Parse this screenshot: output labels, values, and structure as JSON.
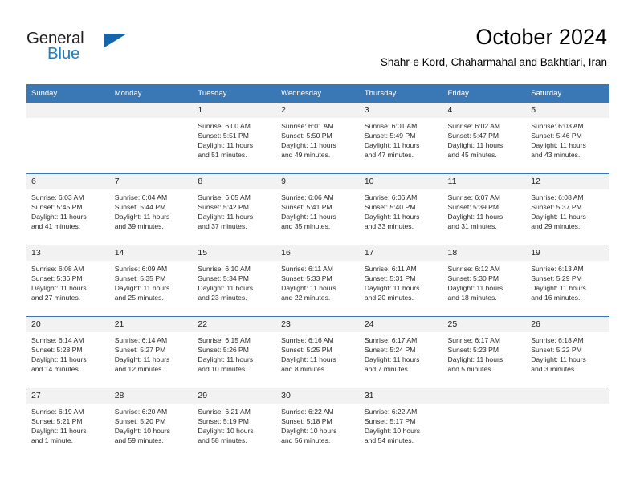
{
  "brand": {
    "name_part1": "General",
    "name_part2": "Blue",
    "logo_icon": "triangle-logo-icon",
    "accent_color": "#1f7fc4",
    "header_color": "#3a78b5"
  },
  "header": {
    "title": "October 2024",
    "subtitle": "Shahr-e Kord, Chaharmahal and Bakhtiari, Iran"
  },
  "weekday_headers": [
    "Sunday",
    "Monday",
    "Tuesday",
    "Wednesday",
    "Thursday",
    "Friday",
    "Saturday"
  ],
  "weeks": [
    [
      {
        "day": "",
        "empty": true,
        "sunrise": "",
        "sunset": "",
        "daylight1": "",
        "daylight2": ""
      },
      {
        "day": "",
        "empty": true,
        "sunrise": "",
        "sunset": "",
        "daylight1": "",
        "daylight2": ""
      },
      {
        "day": "1",
        "sunrise": "Sunrise: 6:00 AM",
        "sunset": "Sunset: 5:51 PM",
        "daylight1": "Daylight: 11 hours",
        "daylight2": "and 51 minutes."
      },
      {
        "day": "2",
        "sunrise": "Sunrise: 6:01 AM",
        "sunset": "Sunset: 5:50 PM",
        "daylight1": "Daylight: 11 hours",
        "daylight2": "and 49 minutes."
      },
      {
        "day": "3",
        "sunrise": "Sunrise: 6:01 AM",
        "sunset": "Sunset: 5:49 PM",
        "daylight1": "Daylight: 11 hours",
        "daylight2": "and 47 minutes."
      },
      {
        "day": "4",
        "sunrise": "Sunrise: 6:02 AM",
        "sunset": "Sunset: 5:47 PM",
        "daylight1": "Daylight: 11 hours",
        "daylight2": "and 45 minutes."
      },
      {
        "day": "5",
        "sunrise": "Sunrise: 6:03 AM",
        "sunset": "Sunset: 5:46 PM",
        "daylight1": "Daylight: 11 hours",
        "daylight2": "and 43 minutes."
      }
    ],
    [
      {
        "day": "6",
        "sunrise": "Sunrise: 6:03 AM",
        "sunset": "Sunset: 5:45 PM",
        "daylight1": "Daylight: 11 hours",
        "daylight2": "and 41 minutes."
      },
      {
        "day": "7",
        "sunrise": "Sunrise: 6:04 AM",
        "sunset": "Sunset: 5:44 PM",
        "daylight1": "Daylight: 11 hours",
        "daylight2": "and 39 minutes."
      },
      {
        "day": "8",
        "sunrise": "Sunrise: 6:05 AM",
        "sunset": "Sunset: 5:42 PM",
        "daylight1": "Daylight: 11 hours",
        "daylight2": "and 37 minutes."
      },
      {
        "day": "9",
        "sunrise": "Sunrise: 6:06 AM",
        "sunset": "Sunset: 5:41 PM",
        "daylight1": "Daylight: 11 hours",
        "daylight2": "and 35 minutes."
      },
      {
        "day": "10",
        "sunrise": "Sunrise: 6:06 AM",
        "sunset": "Sunset: 5:40 PM",
        "daylight1": "Daylight: 11 hours",
        "daylight2": "and 33 minutes."
      },
      {
        "day": "11",
        "sunrise": "Sunrise: 6:07 AM",
        "sunset": "Sunset: 5:39 PM",
        "daylight1": "Daylight: 11 hours",
        "daylight2": "and 31 minutes."
      },
      {
        "day": "12",
        "sunrise": "Sunrise: 6:08 AM",
        "sunset": "Sunset: 5:37 PM",
        "daylight1": "Daylight: 11 hours",
        "daylight2": "and 29 minutes."
      }
    ],
    [
      {
        "day": "13",
        "sunrise": "Sunrise: 6:08 AM",
        "sunset": "Sunset: 5:36 PM",
        "daylight1": "Daylight: 11 hours",
        "daylight2": "and 27 minutes."
      },
      {
        "day": "14",
        "sunrise": "Sunrise: 6:09 AM",
        "sunset": "Sunset: 5:35 PM",
        "daylight1": "Daylight: 11 hours",
        "daylight2": "and 25 minutes."
      },
      {
        "day": "15",
        "sunrise": "Sunrise: 6:10 AM",
        "sunset": "Sunset: 5:34 PM",
        "daylight1": "Daylight: 11 hours",
        "daylight2": "and 23 minutes."
      },
      {
        "day": "16",
        "sunrise": "Sunrise: 6:11 AM",
        "sunset": "Sunset: 5:33 PM",
        "daylight1": "Daylight: 11 hours",
        "daylight2": "and 22 minutes."
      },
      {
        "day": "17",
        "sunrise": "Sunrise: 6:11 AM",
        "sunset": "Sunset: 5:31 PM",
        "daylight1": "Daylight: 11 hours",
        "daylight2": "and 20 minutes."
      },
      {
        "day": "18",
        "sunrise": "Sunrise: 6:12 AM",
        "sunset": "Sunset: 5:30 PM",
        "daylight1": "Daylight: 11 hours",
        "daylight2": "and 18 minutes."
      },
      {
        "day": "19",
        "sunrise": "Sunrise: 6:13 AM",
        "sunset": "Sunset: 5:29 PM",
        "daylight1": "Daylight: 11 hours",
        "daylight2": "and 16 minutes."
      }
    ],
    [
      {
        "day": "20",
        "sunrise": "Sunrise: 6:14 AM",
        "sunset": "Sunset: 5:28 PM",
        "daylight1": "Daylight: 11 hours",
        "daylight2": "and 14 minutes."
      },
      {
        "day": "21",
        "sunrise": "Sunrise: 6:14 AM",
        "sunset": "Sunset: 5:27 PM",
        "daylight1": "Daylight: 11 hours",
        "daylight2": "and 12 minutes."
      },
      {
        "day": "22",
        "sunrise": "Sunrise: 6:15 AM",
        "sunset": "Sunset: 5:26 PM",
        "daylight1": "Daylight: 11 hours",
        "daylight2": "and 10 minutes."
      },
      {
        "day": "23",
        "sunrise": "Sunrise: 6:16 AM",
        "sunset": "Sunset: 5:25 PM",
        "daylight1": "Daylight: 11 hours",
        "daylight2": "and 8 minutes."
      },
      {
        "day": "24",
        "sunrise": "Sunrise: 6:17 AM",
        "sunset": "Sunset: 5:24 PM",
        "daylight1": "Daylight: 11 hours",
        "daylight2": "and 7 minutes."
      },
      {
        "day": "25",
        "sunrise": "Sunrise: 6:17 AM",
        "sunset": "Sunset: 5:23 PM",
        "daylight1": "Daylight: 11 hours",
        "daylight2": "and 5 minutes."
      },
      {
        "day": "26",
        "sunrise": "Sunrise: 6:18 AM",
        "sunset": "Sunset: 5:22 PM",
        "daylight1": "Daylight: 11 hours",
        "daylight2": "and 3 minutes."
      }
    ],
    [
      {
        "day": "27",
        "sunrise": "Sunrise: 6:19 AM",
        "sunset": "Sunset: 5:21 PM",
        "daylight1": "Daylight: 11 hours",
        "daylight2": "and 1 minute."
      },
      {
        "day": "28",
        "sunrise": "Sunrise: 6:20 AM",
        "sunset": "Sunset: 5:20 PM",
        "daylight1": "Daylight: 10 hours",
        "daylight2": "and 59 minutes."
      },
      {
        "day": "29",
        "sunrise": "Sunrise: 6:21 AM",
        "sunset": "Sunset: 5:19 PM",
        "daylight1": "Daylight: 10 hours",
        "daylight2": "and 58 minutes."
      },
      {
        "day": "30",
        "sunrise": "Sunrise: 6:22 AM",
        "sunset": "Sunset: 5:18 PM",
        "daylight1": "Daylight: 10 hours",
        "daylight2": "and 56 minutes."
      },
      {
        "day": "31",
        "sunrise": "Sunrise: 6:22 AM",
        "sunset": "Sunset: 5:17 PM",
        "daylight1": "Daylight: 10 hours",
        "daylight2": "and 54 minutes."
      },
      {
        "day": "",
        "empty": true,
        "sunrise": "",
        "sunset": "",
        "daylight1": "",
        "daylight2": ""
      },
      {
        "day": "",
        "empty": true,
        "sunrise": "",
        "sunset": "",
        "daylight1": "",
        "daylight2": ""
      }
    ]
  ]
}
